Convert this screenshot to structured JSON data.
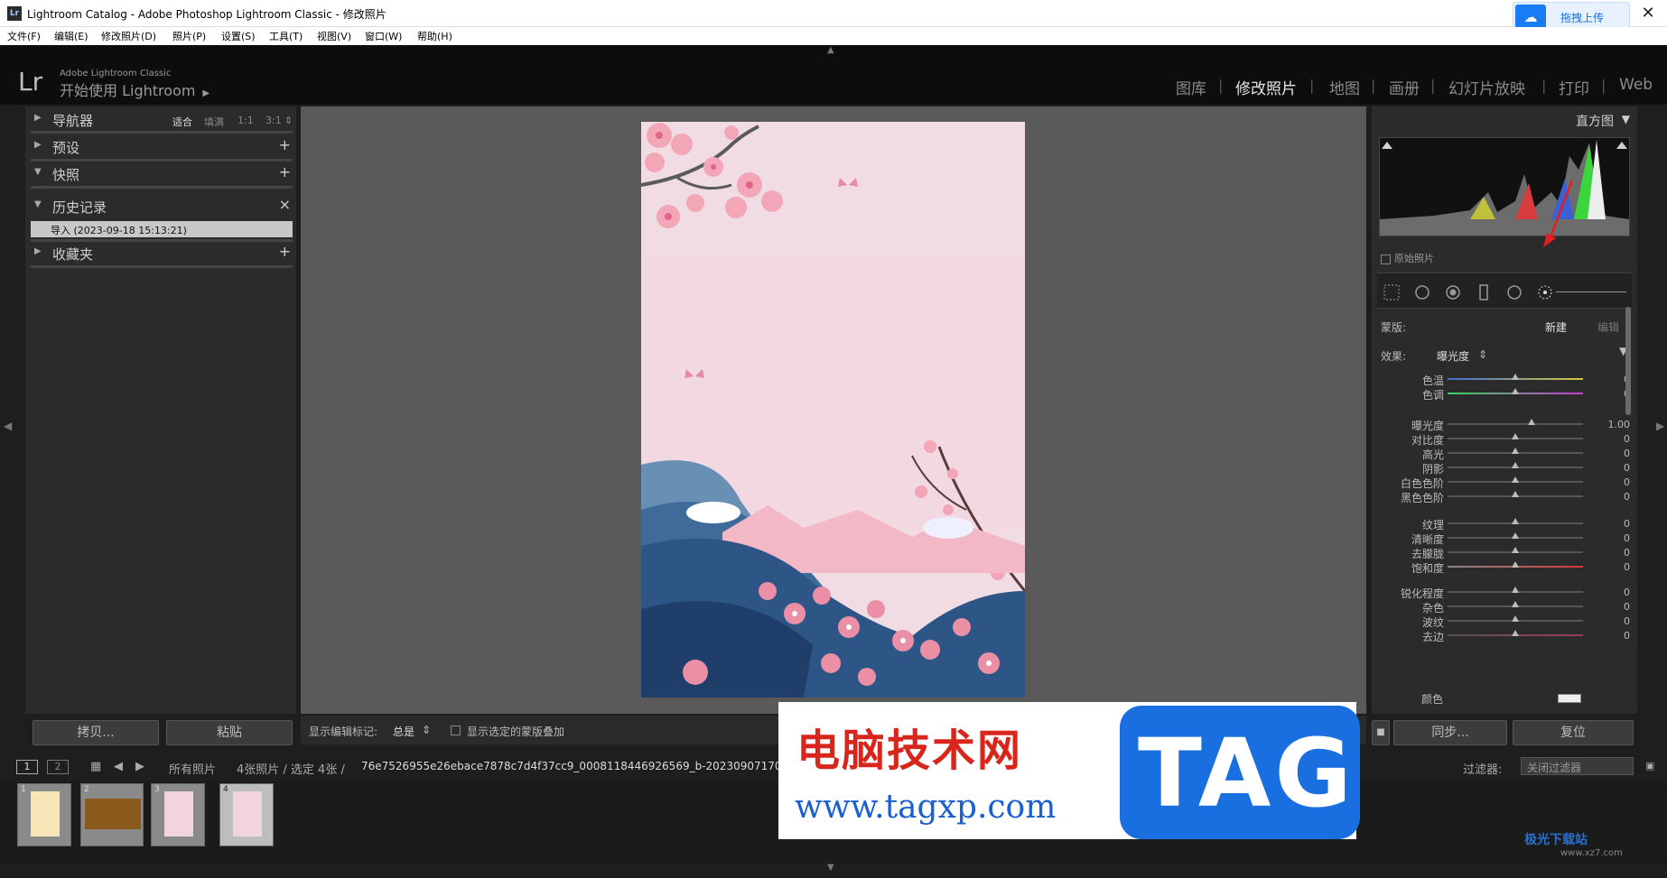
{
  "window": {
    "title": "Lightroom Catalog - Adobe Photoshop Lightroom Classic - 修改照片",
    "app_icon": "Lr",
    "upload_button": "拖拽上传",
    "close": "✕"
  },
  "menu": [
    "文件(F)",
    "编辑(E)",
    "修改照片(D)",
    "照片(P)",
    "设置(S)",
    "工具(T)",
    "视图(V)",
    "窗口(W)",
    "帮助(H)"
  ],
  "identity": {
    "logo": "Lr",
    "small": "Adobe Lightroom Classic",
    "large": "开始使用 Lightroom",
    "arrow": "▶"
  },
  "modules": [
    {
      "label": "图库",
      "active": false
    },
    {
      "label": "修改照片",
      "active": true
    },
    {
      "label": "地图",
      "active": false
    },
    {
      "label": "画册",
      "active": false
    },
    {
      "label": "幻灯片放映",
      "active": false
    },
    {
      "label": "打印",
      "active": false
    },
    {
      "label": "Web",
      "active": false
    }
  ],
  "left_panel": {
    "navigator": {
      "label": "导航器",
      "zoom": [
        "适合",
        "填满",
        "1:1",
        "3:1"
      ]
    },
    "presets": "预设",
    "snapshots": "快照",
    "history": "历史记录",
    "history_item": "导入 (2023-09-18 15:13:21)",
    "collections": "收藏夹",
    "copy_button": "拷贝...",
    "paste_button": "粘贴"
  },
  "toolbar": {
    "show_edit_pins_label": "显示编辑标记:",
    "show_edit_pins_value": "总是",
    "show_mask_overlay": "显示选定的蒙版叠加"
  },
  "right_panel": {
    "histogram_title": "直方图",
    "original_photo": "原始照片",
    "mask_label": "蒙版:",
    "mask_new": "新建",
    "mask_edit": "编辑",
    "effect_label": "效果:",
    "effect_value": "曝光度",
    "sliders": [
      {
        "label": "色温",
        "value": "0",
        "pos": 0.5
      },
      {
        "label": "色调",
        "value": "0",
        "pos": 0.5
      },
      {
        "label": "曝光度",
        "value": "1.00",
        "pos": 0.62
      },
      {
        "label": "对比度",
        "value": "0",
        "pos": 0.5
      },
      {
        "label": "高光",
        "value": "0",
        "pos": 0.5
      },
      {
        "label": "阴影",
        "value": "0",
        "pos": 0.5
      },
      {
        "label": "白色色阶",
        "value": "0",
        "pos": 0.5
      },
      {
        "label": "黑色色阶",
        "value": "0",
        "pos": 0.5
      },
      {
        "label": "纹理",
        "value": "0",
        "pos": 0.5
      },
      {
        "label": "清晰度",
        "value": "0",
        "pos": 0.5
      },
      {
        "label": "去朦胧",
        "value": "0",
        "pos": 0.5
      },
      {
        "label": "饱和度",
        "value": "0",
        "pos": 0.5
      },
      {
        "label": "锐化程度",
        "value": "0",
        "pos": 0.5
      },
      {
        "label": "杂色",
        "value": "0",
        "pos": 0.5
      },
      {
        "label": "波纹",
        "value": "0",
        "pos": 0.5
      },
      {
        "label": "去边",
        "value": "0",
        "pos": 0.5
      }
    ],
    "color_label": "颜色",
    "sync_button": "同步...",
    "reset_button": "复位"
  },
  "filmstrip_bar": {
    "monitor1": "1",
    "monitor2": "2",
    "source": "所有照片",
    "count": "4张照片 / 选定 4张 /",
    "filename": "76e7526955e26ebace7878c7d4f37cc9_0008118446926569_b-20230907170150-x6cpn94.jpg",
    "filter_label": "过滤器:",
    "filter_value": "关闭过滤器"
  },
  "thumbnails": [
    "1",
    "2",
    "3",
    "4"
  ],
  "watermark": {
    "title": "电脑技术网",
    "url": "www.tagxp.com",
    "tag": "TAG",
    "corner": "极光下载站",
    "corner_url": "www.xz7.com"
  },
  "colors": {
    "accent": "#1a6fe0",
    "panel": "#2b2b2b",
    "workarea": "#5a5a5a"
  }
}
